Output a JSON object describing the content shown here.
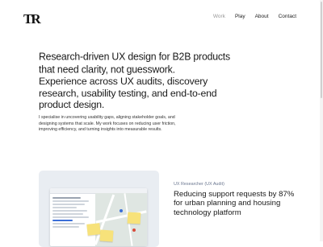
{
  "brand": {
    "logo": "TR"
  },
  "nav": {
    "items": [
      {
        "label": "Work",
        "active": true
      },
      {
        "label": "Play",
        "active": false
      },
      {
        "label": "About",
        "active": false
      },
      {
        "label": "Contact",
        "active": false
      }
    ]
  },
  "hero": {
    "headline": "Research-driven UX design for B2B products that need clarity, not guesswork.",
    "subheadline": "Experience across UX audits, discovery research, usability testing, and end-to-end product design."
  },
  "intro": "I specialise in uncovering usability gaps, aligning stakeholder goals, and designing systems that scale. My work focuses on reducing user friction, improving efficiency, and turning insights into measurable results.",
  "case_study": {
    "tag": "UX Researcher (UX Audit)",
    "title": "Reducing support requests by 87% for urban planning and housing technology platform"
  }
}
